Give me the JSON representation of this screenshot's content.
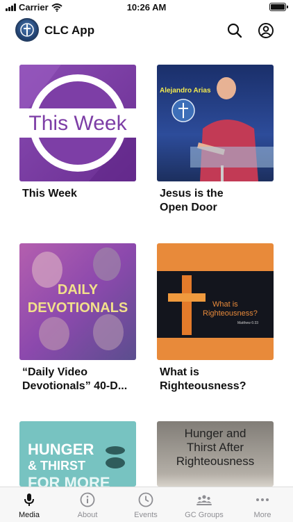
{
  "status_bar": {
    "carrier": "Carrier",
    "time": "10:26 AM"
  },
  "header": {
    "title": "CLC App"
  },
  "media_items": [
    {
      "title": "This Week",
      "thumb_text": "This Week",
      "thumb_color": "#7b3fa0"
    },
    {
      "title": "Jesus is the\nOpen Door",
      "thumb_text": "Alejandro Arias",
      "thumb_color": "#1c3b7a"
    },
    {
      "title": "“Daily Video\nDevotionals” 40-D...",
      "thumb_text_line1": "DAILY",
      "thumb_text_line2": "DEVOTIONALS",
      "thumb_color": "#9b4fae"
    },
    {
      "title": "What is\nRighteousness?",
      "thumb_text_line1": "What is",
      "thumb_text_line2": "Righteousness?",
      "thumb_caption": "Matthew 6:33",
      "thumb_color": "#e88a3a"
    },
    {
      "title": "",
      "thumb_text_line1": "HUNGER",
      "thumb_text_line2": "& THIRST",
      "thumb_text_line3": "FOR MORE",
      "thumb_color": "#72c1bf"
    },
    {
      "title": "",
      "thumb_text_line1": "Hunger and",
      "thumb_text_line2": "Thirst After",
      "thumb_text_line3": "Righteousness",
      "thumb_color": "#8e8a83"
    }
  ],
  "tabs": [
    {
      "label": "Media",
      "icon": "microphone-icon",
      "active": true
    },
    {
      "label": "About",
      "icon": "info-icon",
      "active": false
    },
    {
      "label": "Events",
      "icon": "clock-icon",
      "active": false
    },
    {
      "label": "GC Groups",
      "icon": "groups-icon",
      "active": false
    },
    {
      "label": "More",
      "icon": "more-icon",
      "active": false
    }
  ],
  "colors": {
    "active_tab": "#111111",
    "inactive_tab": "#8e8e93"
  }
}
